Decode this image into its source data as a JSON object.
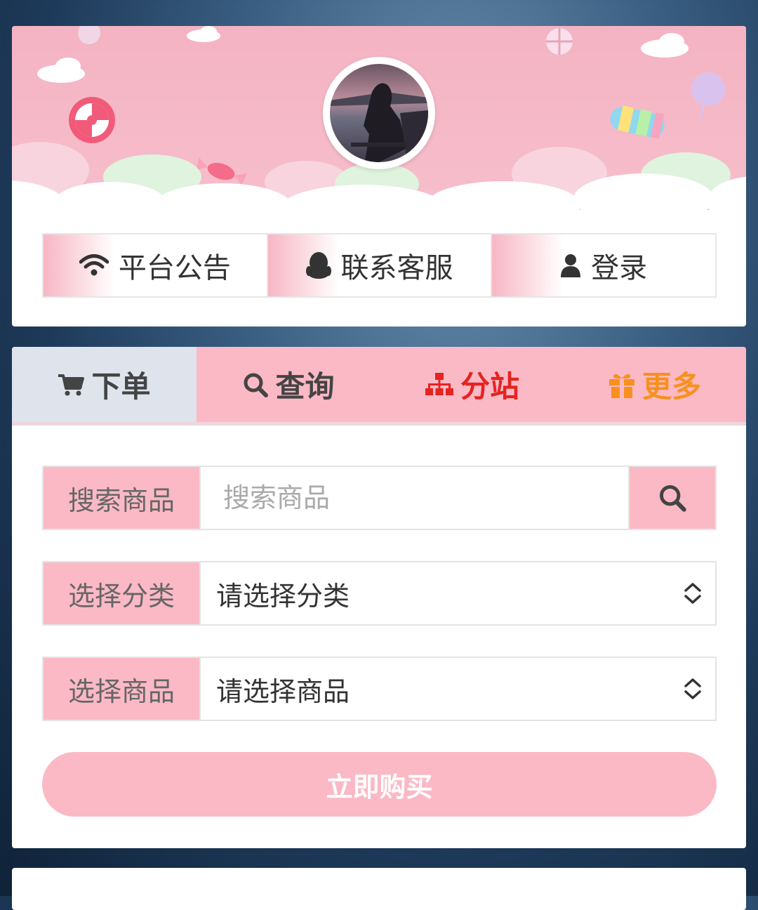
{
  "nav": {
    "notice": {
      "label": "平台公告",
      "icon": "wifi-icon"
    },
    "service": {
      "label": "联系客服",
      "icon": "qq-penguin-icon"
    },
    "login": {
      "label": "登录",
      "icon": "user-icon"
    }
  },
  "tabs": [
    {
      "label": "下单",
      "icon": "cart-icon",
      "color": "#444444"
    },
    {
      "label": "查询",
      "icon": "search-icon",
      "color": "#444444"
    },
    {
      "label": "分站",
      "icon": "sitemap-icon",
      "color": "#e5231f"
    },
    {
      "label": "更多",
      "icon": "gift-icon",
      "color": "#f7901e"
    }
  ],
  "form": {
    "search": {
      "label": "搜索商品",
      "placeholder": "搜索商品"
    },
    "category": {
      "label": "选择分类",
      "value": "请选择分类"
    },
    "product": {
      "label": "选择商品",
      "value": "请选择商品"
    },
    "buy_label": "立即购买"
  },
  "colors": {
    "accent_pink": "#fbb9c5",
    "tab_active": "#dfe3ec"
  }
}
